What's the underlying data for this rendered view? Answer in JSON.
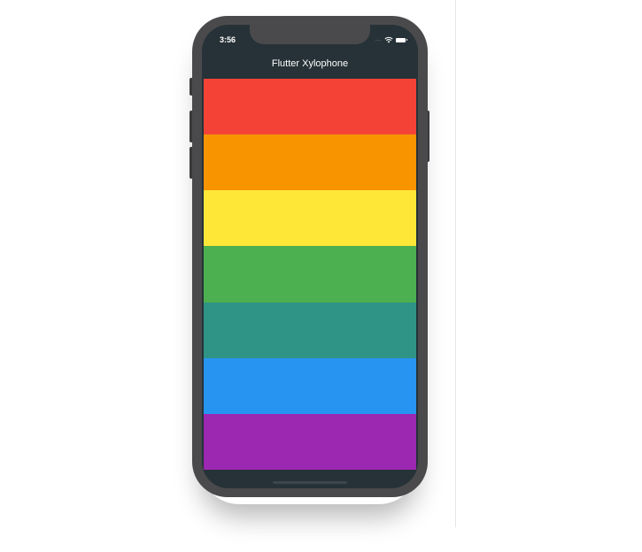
{
  "status_bar": {
    "time": "3:56",
    "signal": "....",
    "wifi_icon": "wifi-icon",
    "battery_icon": "battery-icon"
  },
  "app_bar": {
    "title": "Flutter Xylophone",
    "background": "#263238"
  },
  "keys": [
    {
      "name": "key-1",
      "color": "#f44336"
    },
    {
      "name": "key-2",
      "color": "#f79400"
    },
    {
      "name": "key-3",
      "color": "#ffe737"
    },
    {
      "name": "key-4",
      "color": "#4caf50"
    },
    {
      "name": "key-5",
      "color": "#2f9485"
    },
    {
      "name": "key-6",
      "color": "#2894f1"
    },
    {
      "name": "key-7",
      "color": "#9c27b0"
    }
  ]
}
